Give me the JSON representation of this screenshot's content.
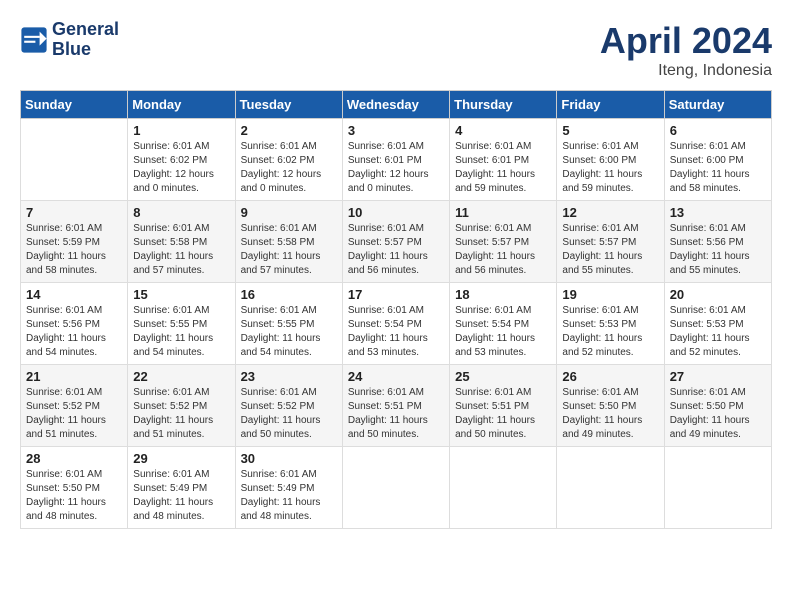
{
  "header": {
    "logo_line1": "General",
    "logo_line2": "Blue",
    "month_year": "April 2024",
    "location": "Iteng, Indonesia"
  },
  "days_of_week": [
    "Sunday",
    "Monday",
    "Tuesday",
    "Wednesday",
    "Thursday",
    "Friday",
    "Saturday"
  ],
  "weeks": [
    [
      {
        "day": "",
        "info": ""
      },
      {
        "day": "1",
        "info": "Sunrise: 6:01 AM\nSunset: 6:02 PM\nDaylight: 12 hours\nand 0 minutes."
      },
      {
        "day": "2",
        "info": "Sunrise: 6:01 AM\nSunset: 6:02 PM\nDaylight: 12 hours\nand 0 minutes."
      },
      {
        "day": "3",
        "info": "Sunrise: 6:01 AM\nSunset: 6:01 PM\nDaylight: 12 hours\nand 0 minutes."
      },
      {
        "day": "4",
        "info": "Sunrise: 6:01 AM\nSunset: 6:01 PM\nDaylight: 11 hours\nand 59 minutes."
      },
      {
        "day": "5",
        "info": "Sunrise: 6:01 AM\nSunset: 6:00 PM\nDaylight: 11 hours\nand 59 minutes."
      },
      {
        "day": "6",
        "info": "Sunrise: 6:01 AM\nSunset: 6:00 PM\nDaylight: 11 hours\nand 58 minutes."
      }
    ],
    [
      {
        "day": "7",
        "info": "Sunrise: 6:01 AM\nSunset: 5:59 PM\nDaylight: 11 hours\nand 58 minutes."
      },
      {
        "day": "8",
        "info": "Sunrise: 6:01 AM\nSunset: 5:58 PM\nDaylight: 11 hours\nand 57 minutes."
      },
      {
        "day": "9",
        "info": "Sunrise: 6:01 AM\nSunset: 5:58 PM\nDaylight: 11 hours\nand 57 minutes."
      },
      {
        "day": "10",
        "info": "Sunrise: 6:01 AM\nSunset: 5:57 PM\nDaylight: 11 hours\nand 56 minutes."
      },
      {
        "day": "11",
        "info": "Sunrise: 6:01 AM\nSunset: 5:57 PM\nDaylight: 11 hours\nand 56 minutes."
      },
      {
        "day": "12",
        "info": "Sunrise: 6:01 AM\nSunset: 5:57 PM\nDaylight: 11 hours\nand 55 minutes."
      },
      {
        "day": "13",
        "info": "Sunrise: 6:01 AM\nSunset: 5:56 PM\nDaylight: 11 hours\nand 55 minutes."
      }
    ],
    [
      {
        "day": "14",
        "info": "Sunrise: 6:01 AM\nSunset: 5:56 PM\nDaylight: 11 hours\nand 54 minutes."
      },
      {
        "day": "15",
        "info": "Sunrise: 6:01 AM\nSunset: 5:55 PM\nDaylight: 11 hours\nand 54 minutes."
      },
      {
        "day": "16",
        "info": "Sunrise: 6:01 AM\nSunset: 5:55 PM\nDaylight: 11 hours\nand 54 minutes."
      },
      {
        "day": "17",
        "info": "Sunrise: 6:01 AM\nSunset: 5:54 PM\nDaylight: 11 hours\nand 53 minutes."
      },
      {
        "day": "18",
        "info": "Sunrise: 6:01 AM\nSunset: 5:54 PM\nDaylight: 11 hours\nand 53 minutes."
      },
      {
        "day": "19",
        "info": "Sunrise: 6:01 AM\nSunset: 5:53 PM\nDaylight: 11 hours\nand 52 minutes."
      },
      {
        "day": "20",
        "info": "Sunrise: 6:01 AM\nSunset: 5:53 PM\nDaylight: 11 hours\nand 52 minutes."
      }
    ],
    [
      {
        "day": "21",
        "info": "Sunrise: 6:01 AM\nSunset: 5:52 PM\nDaylight: 11 hours\nand 51 minutes."
      },
      {
        "day": "22",
        "info": "Sunrise: 6:01 AM\nSunset: 5:52 PM\nDaylight: 11 hours\nand 51 minutes."
      },
      {
        "day": "23",
        "info": "Sunrise: 6:01 AM\nSunset: 5:52 PM\nDaylight: 11 hours\nand 50 minutes."
      },
      {
        "day": "24",
        "info": "Sunrise: 6:01 AM\nSunset: 5:51 PM\nDaylight: 11 hours\nand 50 minutes."
      },
      {
        "day": "25",
        "info": "Sunrise: 6:01 AM\nSunset: 5:51 PM\nDaylight: 11 hours\nand 50 minutes."
      },
      {
        "day": "26",
        "info": "Sunrise: 6:01 AM\nSunset: 5:50 PM\nDaylight: 11 hours\nand 49 minutes."
      },
      {
        "day": "27",
        "info": "Sunrise: 6:01 AM\nSunset: 5:50 PM\nDaylight: 11 hours\nand 49 minutes."
      }
    ],
    [
      {
        "day": "28",
        "info": "Sunrise: 6:01 AM\nSunset: 5:50 PM\nDaylight: 11 hours\nand 48 minutes."
      },
      {
        "day": "29",
        "info": "Sunrise: 6:01 AM\nSunset: 5:49 PM\nDaylight: 11 hours\nand 48 minutes."
      },
      {
        "day": "30",
        "info": "Sunrise: 6:01 AM\nSunset: 5:49 PM\nDaylight: 11 hours\nand 48 minutes."
      },
      {
        "day": "",
        "info": ""
      },
      {
        "day": "",
        "info": ""
      },
      {
        "day": "",
        "info": ""
      },
      {
        "day": "",
        "info": ""
      }
    ]
  ]
}
